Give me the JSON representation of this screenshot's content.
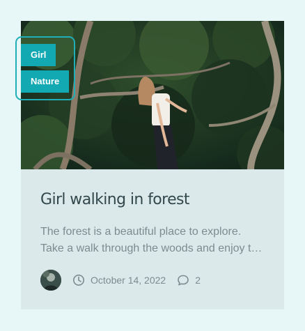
{
  "post": {
    "tags": [
      "Girl",
      "Nature"
    ],
    "title": "Girl walking in forest",
    "excerpt_lines": [
      "The forest is a beautiful place to explore.",
      "Take a walk through the woods and enjoy th…"
    ],
    "date": "October 14, 2022",
    "comments": "2"
  },
  "colors": {
    "accent": "#12a9b3",
    "card_bg": "#dbe9ea",
    "page_bg": "#e7f6f7",
    "title": "#33484d",
    "muted": "#7c8b8e"
  },
  "icons": {
    "date": "clock-icon",
    "comments": "comment-icon"
  }
}
